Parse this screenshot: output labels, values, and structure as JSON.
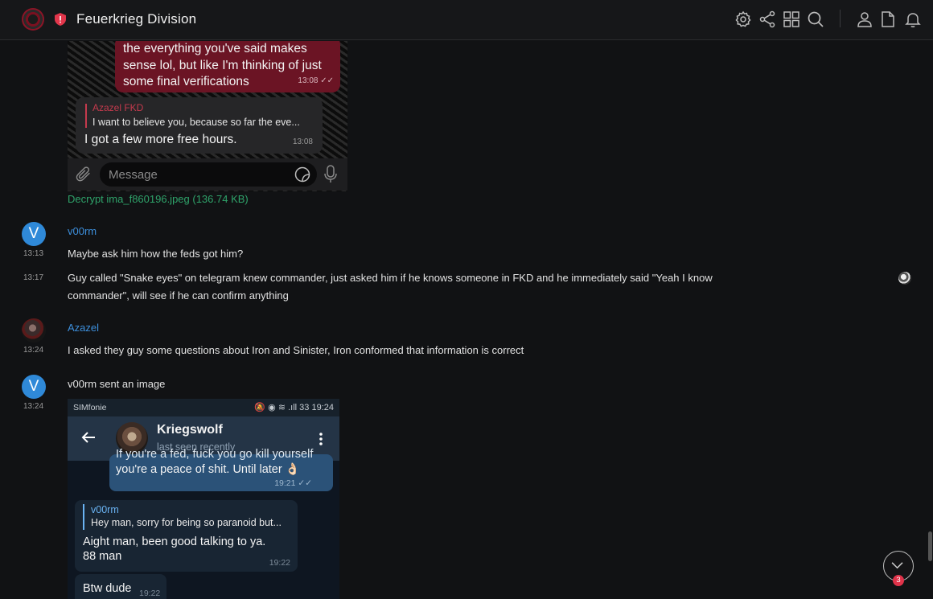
{
  "room": {
    "title": "Feuerkrieg Division",
    "avatar_icon": "room-avatar",
    "badge_icon": "shield-alert-icon"
  },
  "toolbar": {
    "icons": [
      "settings-icon",
      "share-icon",
      "grid-icon",
      "search-icon",
      "user-icon",
      "file-icon",
      "bell-icon"
    ]
  },
  "image1": {
    "own_message": "the everything you've said makes sense lol, but like I'm thinking of just some final verifications",
    "own_time": "13:08",
    "reply_name": "Azazel FKD",
    "reply_text": "I want to believe you, because so far the eve...",
    "incoming_message": "I got a few more free hours.",
    "incoming_time": "13:08",
    "composer_placeholder": "Message"
  },
  "decrypt_link": "Decrypt ima_f860196.jpeg (136.74 KB)",
  "messages": [
    {
      "sender": "v00rm",
      "avatar_letter": "V",
      "time": "13:13",
      "text": "Maybe ask him how the feds got him?"
    },
    {
      "time": "13:17",
      "text": "Guy called \"Snake eyes\" on telegram knew commander, just asked him if he knows someone in FKD and he immediately said \"Yeah I know commander\", will see if he can confirm anything"
    },
    {
      "sender": "Azazel",
      "time": "13:24",
      "text": "I asked they guy some questions about Iron and Sinister, Iron conformed that information is correct"
    },
    {
      "avatar_letter": "V",
      "time": "13:24",
      "text": "v00rm sent an image"
    }
  ],
  "image2": {
    "carrier": "SIMfonie",
    "status_right": "19:24",
    "battery": "33",
    "contact_name": "Kriegswolf",
    "contact_status": "last seen recently",
    "out_message_partial": "If you're a fed, fuck you go kill yourself",
    "out_message": "you're a peace of shit. Until later 👌🏻",
    "out_time": "19:21",
    "reply_name": "v00rm",
    "reply_text": "Hey man, sorry for being so paranoid but...",
    "in_message": "Aight man, been good talking to ya. 88 man",
    "in_time": "19:22",
    "in2_message": "Btw dude",
    "in2_time": "19:22"
  },
  "scroll_badge": "3"
}
